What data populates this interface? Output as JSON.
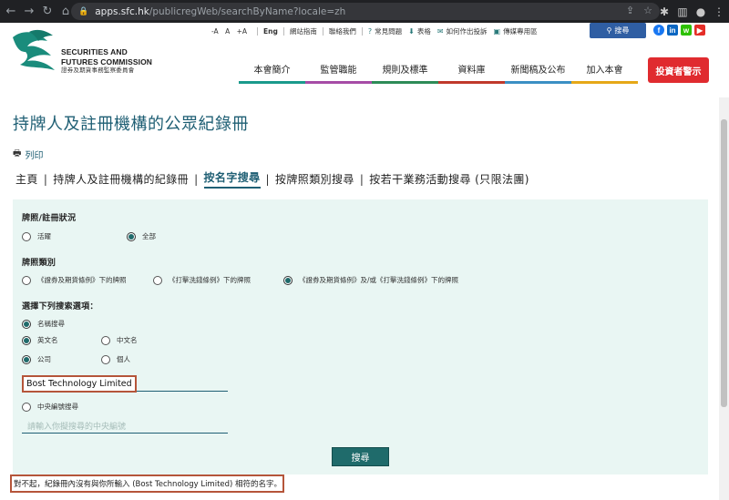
{
  "browser": {
    "url_host": "apps.sfc.hk",
    "url_path": "/publicregWeb/searchByName?locale=zh"
  },
  "header": {
    "logo_en_line1": "SECURITIES AND",
    "logo_en_line2": "FUTURES COMMISSION",
    "logo_zh": "證券及期貨事務監察委員會",
    "font_sizes": [
      "-A",
      "A",
      "+A"
    ],
    "lang": "Eng",
    "util_links": [
      "網站指南",
      "聯絡我們"
    ],
    "util_icon_links": [
      "常見問題",
      "表格",
      "如何作出投訴",
      "傳媒專用區"
    ],
    "search_label": "搜尋",
    "social": [
      "f",
      "in",
      "w",
      "▶"
    ],
    "nav": [
      {
        "label": "本會簡介",
        "color": "#1a9a8c"
      },
      {
        "label": "監管職能",
        "color": "#a64ca6"
      },
      {
        "label": "規則及標準",
        "color": "#2e8b57"
      },
      {
        "label": "資料庫",
        "color": "#c0392b"
      },
      {
        "label": "新聞稿及公布",
        "color": "#3b8fc4"
      },
      {
        "label": "加入本會",
        "color": "#e6a817"
      }
    ],
    "investor_alert": "投資者警示"
  },
  "page": {
    "title": "持牌人及註冊機構的公眾紀錄冊",
    "print": "列印",
    "breadcrumb": [
      "主頁",
      "持牌人及註冊機構的紀錄冊",
      "按名字搜尋",
      "按牌照類別搜尋",
      "按若干業務活動搜尋 (只限法團)"
    ]
  },
  "form": {
    "status_label": "牌照/註冊狀況",
    "status_options": [
      "活躍",
      "全部"
    ],
    "type_label": "牌照類別",
    "type_options": [
      "《證券及期貨條例》下的牌照",
      "《打擊洗錢條例》下的牌照",
      "《證券及期貨條例》及/或《打擊洗錢條例》下的牌照"
    ],
    "search_options_label": "選擇下列搜索選項：",
    "name_search": "名稱搜尋",
    "lang_options": [
      "英文名",
      "中文名"
    ],
    "entity_options": [
      "公司",
      "個人"
    ],
    "name_value": "Bost Technology Limited",
    "ce_search": "中央編號搜尋",
    "ce_placeholder": "請輸入你擬搜尋的中央編號",
    "submit": "搜尋"
  },
  "result": {
    "message": "對不起，紀錄冊內沒有與你所輸入 (Bost Technology Limited) 相符的名字。"
  }
}
